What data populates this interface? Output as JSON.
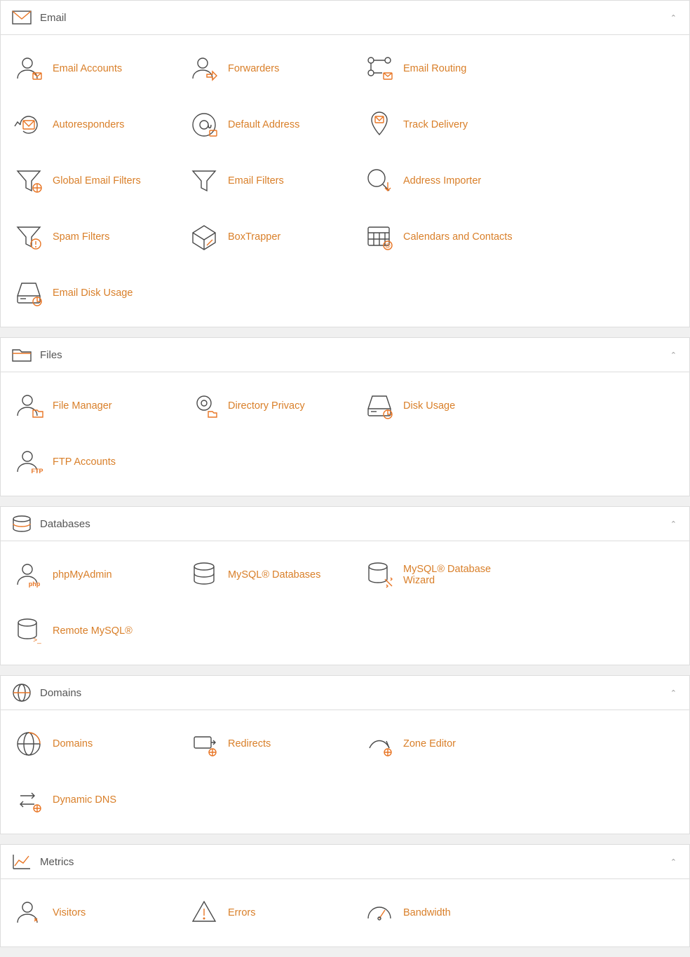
{
  "sections": {
    "email": {
      "title": "Email",
      "items": [
        {
          "label": "Email Accounts",
          "icon": "email-accounts"
        },
        {
          "label": "Forwarders",
          "icon": "forwarders"
        },
        {
          "label": "Email Routing",
          "icon": "email-routing"
        },
        {
          "label": "Autoresponders",
          "icon": "autoresponders"
        },
        {
          "label": "Default Address",
          "icon": "default-address"
        },
        {
          "label": "Track Delivery",
          "icon": "track-delivery"
        },
        {
          "label": "Global Email Filters",
          "icon": "global-email-filters"
        },
        {
          "label": "Email Filters",
          "icon": "email-filters"
        },
        {
          "label": "Address Importer",
          "icon": "address-importer"
        },
        {
          "label": "Spam Filters",
          "icon": "spam-filters"
        },
        {
          "label": "BoxTrapper",
          "icon": "boxtrapper"
        },
        {
          "label": "Calendars and Contacts",
          "icon": "calendars-contacts"
        },
        {
          "label": "Email Disk Usage",
          "icon": "email-disk-usage"
        }
      ]
    },
    "files": {
      "title": "Files",
      "items": [
        {
          "label": "File Manager",
          "icon": "file-manager"
        },
        {
          "label": "Directory Privacy",
          "icon": "directory-privacy"
        },
        {
          "label": "Disk Usage",
          "icon": "disk-usage"
        },
        {
          "label": "FTP Accounts",
          "icon": "ftp-accounts"
        }
      ]
    },
    "databases": {
      "title": "Databases",
      "items": [
        {
          "label": "phpMyAdmin",
          "icon": "phpmyadmin"
        },
        {
          "label": "MySQL® Databases",
          "icon": "mysql-db"
        },
        {
          "label": "MySQL® Database Wizard",
          "icon": "mysql-wizard"
        },
        {
          "label": "Remote MySQL®",
          "icon": "remote-mysql"
        }
      ]
    },
    "domains": {
      "title": "Domains",
      "items": [
        {
          "label": "Domains",
          "icon": "domains"
        },
        {
          "label": "Redirects",
          "icon": "redirects"
        },
        {
          "label": "Zone Editor",
          "icon": "zone-editor"
        },
        {
          "label": "Dynamic DNS",
          "icon": "dynamic-dns"
        }
      ]
    },
    "metrics": {
      "title": "Metrics",
      "items": [
        {
          "label": "Visitors",
          "icon": "visitors"
        },
        {
          "label": "Errors",
          "icon": "errors"
        },
        {
          "label": "Bandwidth",
          "icon": "bandwidth"
        }
      ]
    }
  },
  "colors": {
    "accent": "#e87524",
    "link": "#d97f29",
    "iconDark": "#4a4a4a"
  }
}
